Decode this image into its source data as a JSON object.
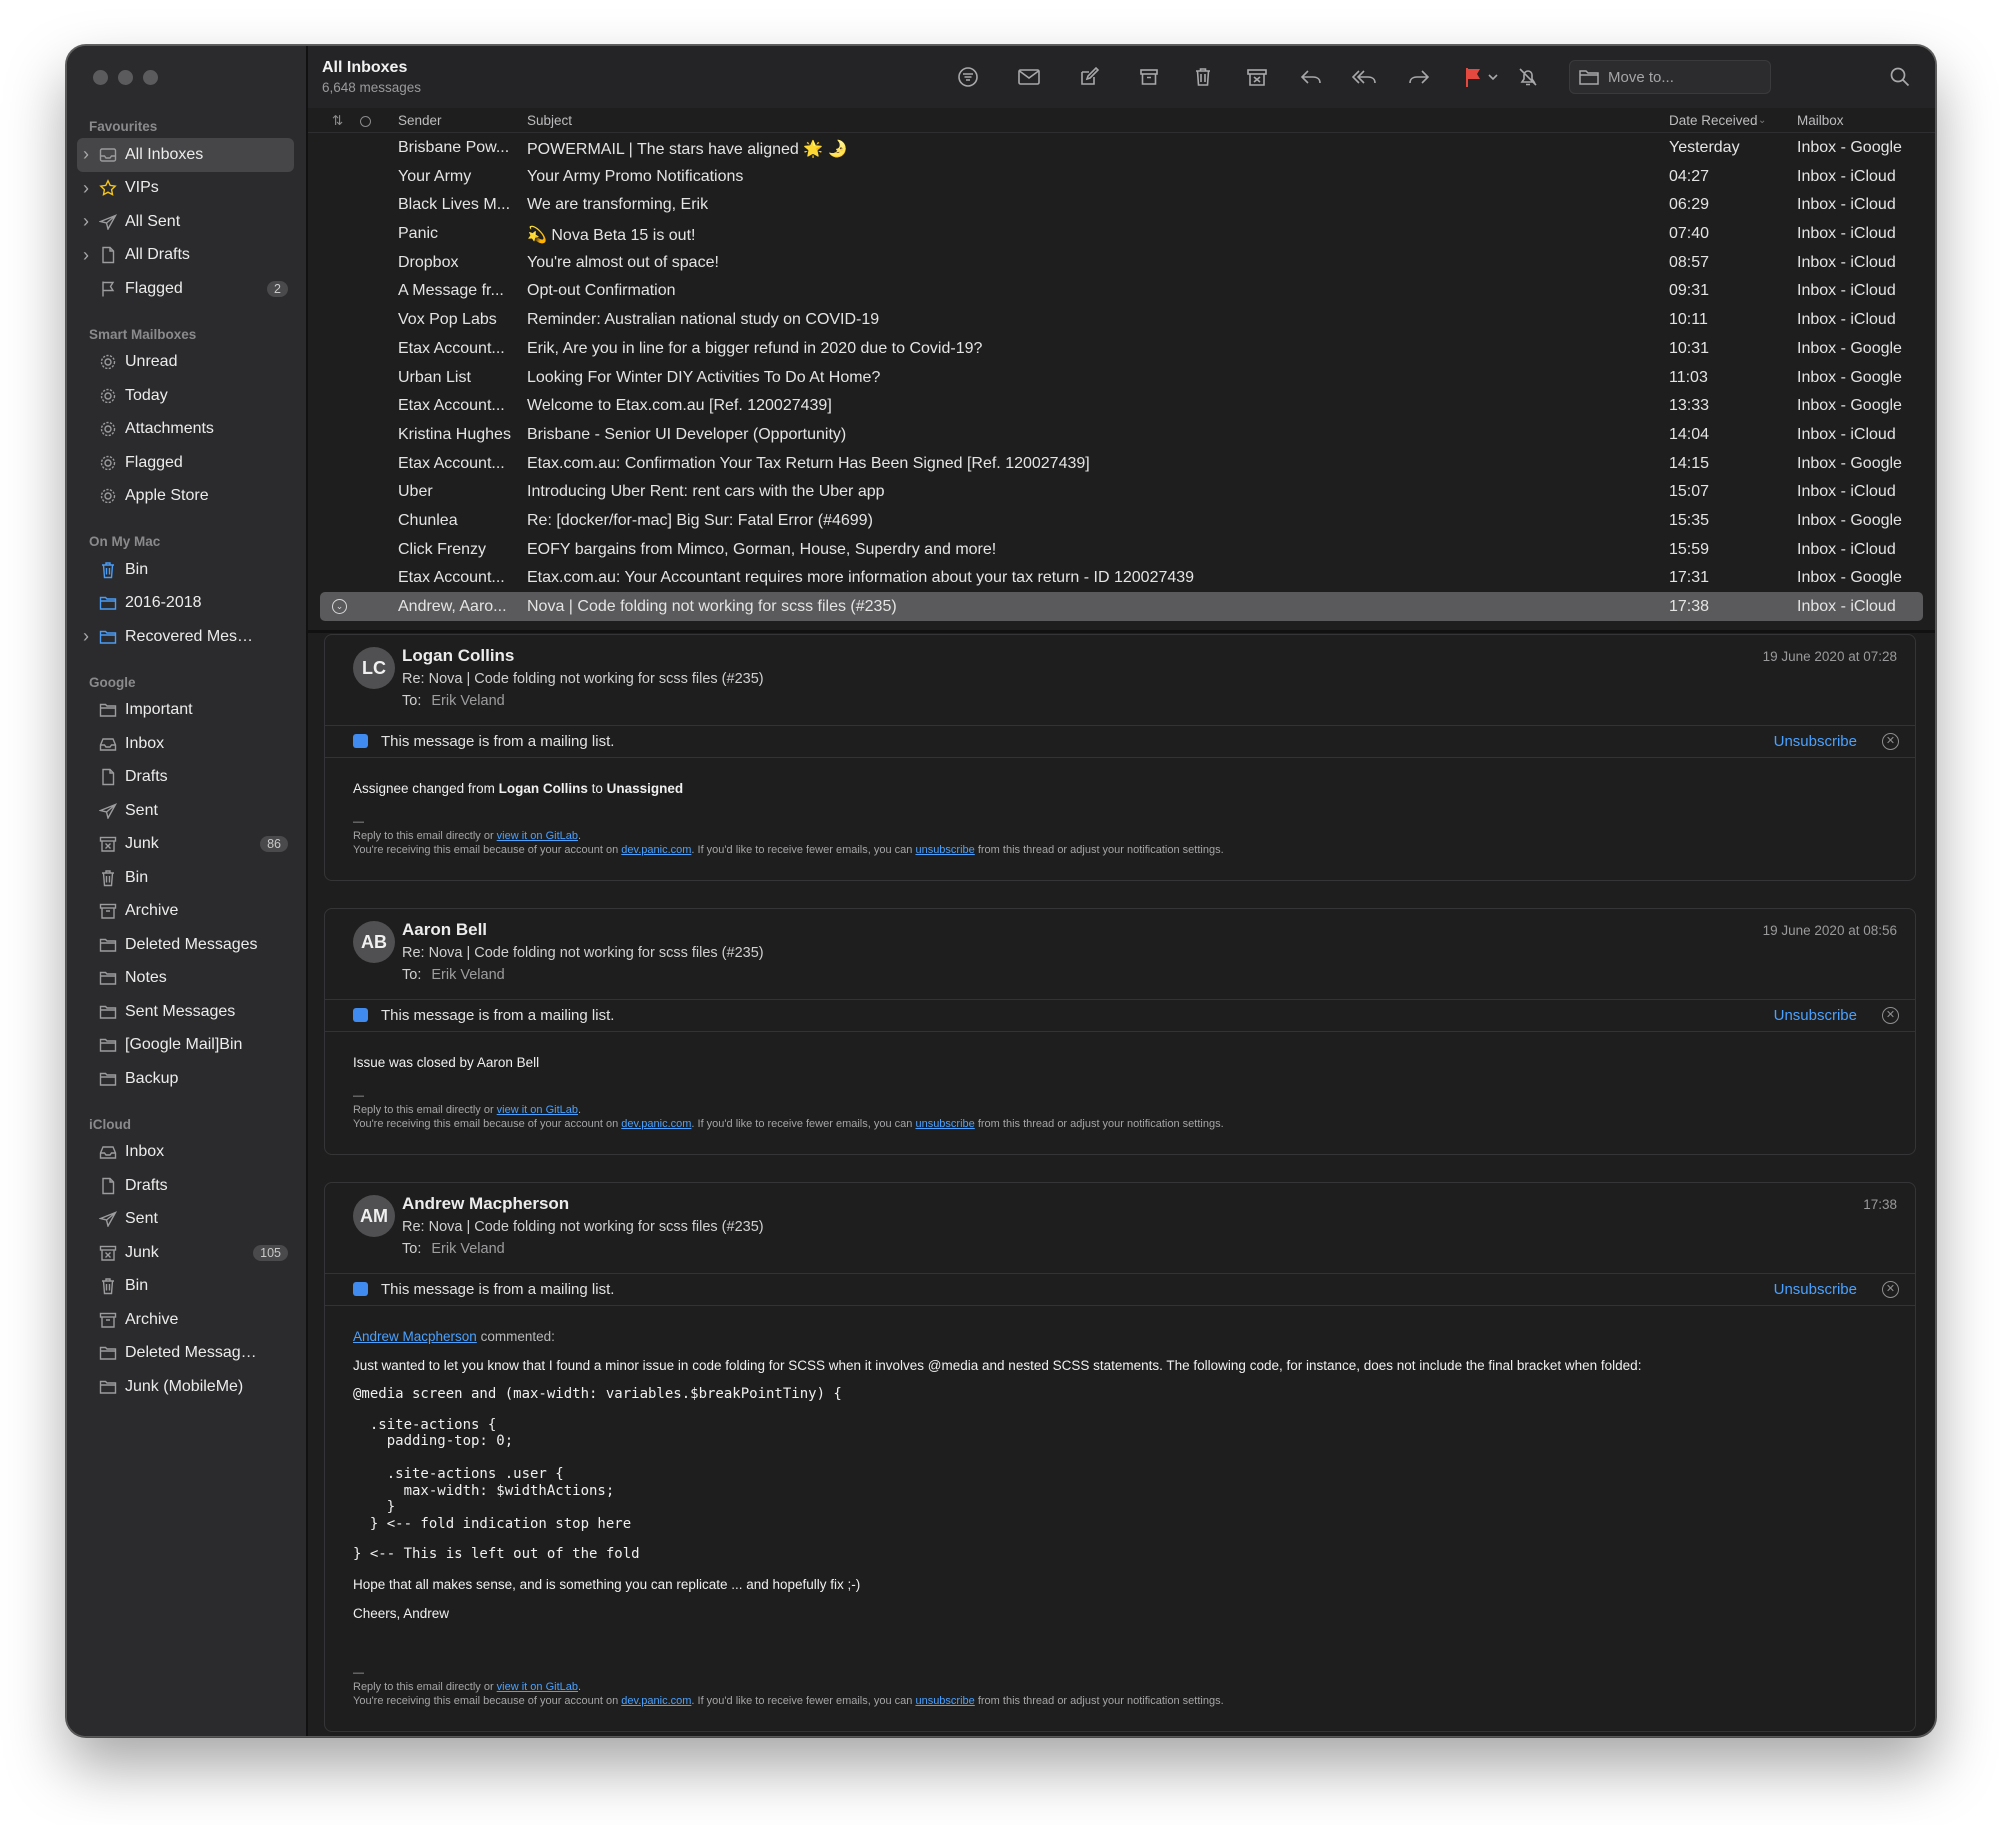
{
  "sidebar": {
    "sections": [
      {
        "title": "Favourites",
        "items": [
          {
            "label": "All Inboxes",
            "icon": "inbox-stack-icon",
            "chevron": true,
            "selected": true
          },
          {
            "label": "VIPs",
            "icon": "star-icon",
            "chevron": true
          },
          {
            "label": "All Sent",
            "icon": "paper-plane-icon",
            "chevron": true
          },
          {
            "label": "All Drafts",
            "icon": "document-icon",
            "chevron": true
          },
          {
            "label": "Flagged",
            "icon": "flag-icon",
            "badge": "2"
          }
        ]
      },
      {
        "title": "Smart Mailboxes",
        "items": [
          {
            "label": "Unread",
            "icon": "gear-icon"
          },
          {
            "label": "Today",
            "icon": "gear-icon"
          },
          {
            "label": "Attachments",
            "icon": "gear-icon"
          },
          {
            "label": "Flagged",
            "icon": "gear-icon"
          },
          {
            "label": "Apple Store",
            "icon": "gear-icon"
          }
        ]
      },
      {
        "title": "On My Mac",
        "items": [
          {
            "label": "Bin",
            "icon": "trash-blue-icon"
          },
          {
            "label": "2016-2018",
            "icon": "folder-blue-icon"
          },
          {
            "label": "Recovered Messag...",
            "icon": "folder-blue-icon",
            "chevron": true
          }
        ]
      },
      {
        "title": "Google",
        "items": [
          {
            "label": "Important",
            "icon": "folder-icon"
          },
          {
            "label": "Inbox",
            "icon": "inbox-icon"
          },
          {
            "label": "Drafts",
            "icon": "document-icon"
          },
          {
            "label": "Sent",
            "icon": "paper-plane-icon"
          },
          {
            "label": "Junk",
            "icon": "junk-icon",
            "badge": "86"
          },
          {
            "label": "Bin",
            "icon": "trash-icon"
          },
          {
            "label": "Archive",
            "icon": "archive-icon"
          },
          {
            "label": "Deleted Messages",
            "icon": "folder-icon"
          },
          {
            "label": "Notes",
            "icon": "folder-icon"
          },
          {
            "label": "Sent Messages",
            "icon": "folder-icon"
          },
          {
            "label": "[Google Mail]Bin",
            "icon": "folder-icon"
          },
          {
            "label": "Backup",
            "icon": "folder-icon"
          }
        ]
      },
      {
        "title": "iCloud",
        "items": [
          {
            "label": "Inbox",
            "icon": "inbox-icon"
          },
          {
            "label": "Drafts",
            "icon": "document-icon"
          },
          {
            "label": "Sent",
            "icon": "paper-plane-icon"
          },
          {
            "label": "Junk",
            "icon": "junk-icon",
            "badge": "105"
          },
          {
            "label": "Bin",
            "icon": "trash-icon"
          },
          {
            "label": "Archive",
            "icon": "archive-icon"
          },
          {
            "label": "Deleted Messages (...",
            "icon": "folder-icon"
          },
          {
            "label": "Junk (MobileMe)",
            "icon": "folder-icon"
          }
        ]
      }
    ]
  },
  "toolbar": {
    "title": "All Inboxes",
    "subtitle": "6,648 messages",
    "move_to_placeholder": "Move to...",
    "flag_color": "#e5483f"
  },
  "list": {
    "headers": {
      "sender": "Sender",
      "subject": "Subject",
      "date": "Date Received",
      "mailbox": "Mailbox"
    },
    "rows": [
      {
        "sender": "Brisbane Pow...",
        "subject": "POWERMAIL | The stars have aligned 🌟 🌛",
        "date": "Yesterday",
        "mailbox": "Inbox - Google"
      },
      {
        "sender": "Your Army",
        "subject": "Your Army Promo Notifications",
        "date": "04:27",
        "mailbox": "Inbox - iCloud"
      },
      {
        "sender": "Black Lives M...",
        "subject": "We are transforming, Erik",
        "date": "06:29",
        "mailbox": "Inbox - iCloud"
      },
      {
        "sender": "Panic",
        "subject": "💫 Nova Beta 15 is out!",
        "date": "07:40",
        "mailbox": "Inbox - iCloud"
      },
      {
        "sender": "Dropbox",
        "subject": "You're almost out of space!",
        "date": "08:57",
        "mailbox": "Inbox - iCloud"
      },
      {
        "sender": "A Message fr...",
        "subject": "Opt-out Confirmation",
        "date": "09:31",
        "mailbox": "Inbox - iCloud"
      },
      {
        "sender": "Vox Pop Labs",
        "subject": "Reminder: Australian national study on COVID-19",
        "date": "10:11",
        "mailbox": "Inbox - iCloud"
      },
      {
        "sender": "Etax Account...",
        "subject": "Erik, Are you in line for a bigger refund in 2020 due to Covid-19?",
        "date": "10:31",
        "mailbox": "Inbox - Google"
      },
      {
        "sender": "Urban List",
        "subject": "Looking For Winter DIY Activities To Do At Home?",
        "date": "11:03",
        "mailbox": "Inbox - Google"
      },
      {
        "sender": "Etax Account...",
        "subject": "Welcome to Etax.com.au [Ref. 120027439]",
        "date": "13:33",
        "mailbox": "Inbox - Google"
      },
      {
        "sender": "Kristina Hughes",
        "subject": "Brisbane - Senior UI Developer (Opportunity)",
        "date": "14:04",
        "mailbox": "Inbox - iCloud"
      },
      {
        "sender": "Etax Account...",
        "subject": "Etax.com.au: Confirmation Your Tax Return Has Been Signed [Ref. 120027439]",
        "date": "14:15",
        "mailbox": "Inbox - Google"
      },
      {
        "sender": "Uber",
        "subject": "Introducing Uber Rent: rent cars with the Uber app",
        "date": "15:07",
        "mailbox": "Inbox - iCloud"
      },
      {
        "sender": "Chunlea",
        "subject": "Re: [docker/for-mac] Big Sur: Fatal Error (#4699)",
        "date": "15:35",
        "mailbox": "Inbox - Google"
      },
      {
        "sender": "Click Frenzy",
        "subject": "EOFY bargains from Mimco, Gorman, House, Superdry and more!",
        "date": "15:59",
        "mailbox": "Inbox - iCloud"
      },
      {
        "sender": "Etax Account...",
        "subject": "Etax.com.au: Your Accountant requires more information about your tax return - ID 120027439",
        "date": "17:31",
        "mailbox": "Inbox - Google"
      },
      {
        "sender": "Andrew, Aaro...",
        "subject": "Nova | Code folding not working for scss files (#235)",
        "date": "17:38",
        "mailbox": "Inbox - iCloud",
        "selected": true
      }
    ]
  },
  "messages": {
    "mailing_list_text": "This message is from a mailing list.",
    "unsubscribe_label": "Unsubscribe",
    "to_label": "To:",
    "to_name": "Erik Veland",
    "subject": "Re: Nova | Code folding not working for scss files (#235)",
    "footer": {
      "dash": "—",
      "reply_prefix": "Reply to this email directly or ",
      "reply_link": "view it on GitLab",
      "reply_suffix": ".",
      "recv_prefix": "You're receiving this email because of your account on ",
      "recv_link": "dev.panic.com",
      "recv_mid": ". If you'd like to receive fewer emails, you can ",
      "recv_link2": "unsubscribe",
      "recv_suffix": " from this thread or adjust your notification settings."
    },
    "m1": {
      "initials": "LC",
      "from": "Logan Collins",
      "date": "19 June 2020 at 07:28",
      "body_a": "Assignee changed from ",
      "body_b": "Logan Collins",
      "body_c": " to ",
      "body_d": "Unassigned"
    },
    "m2": {
      "initials": "AB",
      "from": "Aaron Bell",
      "date": "19 June 2020 at 08:56",
      "body": "Issue was closed by Aaron Bell"
    },
    "m3": {
      "initials": "AM",
      "from": "Andrew Macpherson",
      "date": "17:38",
      "author_link": "Andrew Macpherson",
      "commented": " commented:",
      "p1": "Just wanted to let you know that I found a minor issue in code folding for SCSS when it involves @media and nested SCSS statements. The following code, for instance, does not include the final bracket when folded:",
      "code1": "@media screen and (max-width: variables.$breakPointTiny) {",
      "code2": "  .site-actions {\n    padding-top: 0;\n\n    .site-actions .user {\n      max-width: $widthActions;\n    }\n  } <-- fold indication stop here",
      "code3": "} <-- This is left out of the fold",
      "p2": "Hope that all makes sense, and is something you can replicate ... and hopefully fix ;-)",
      "p3": "Cheers, Andrew"
    }
  }
}
